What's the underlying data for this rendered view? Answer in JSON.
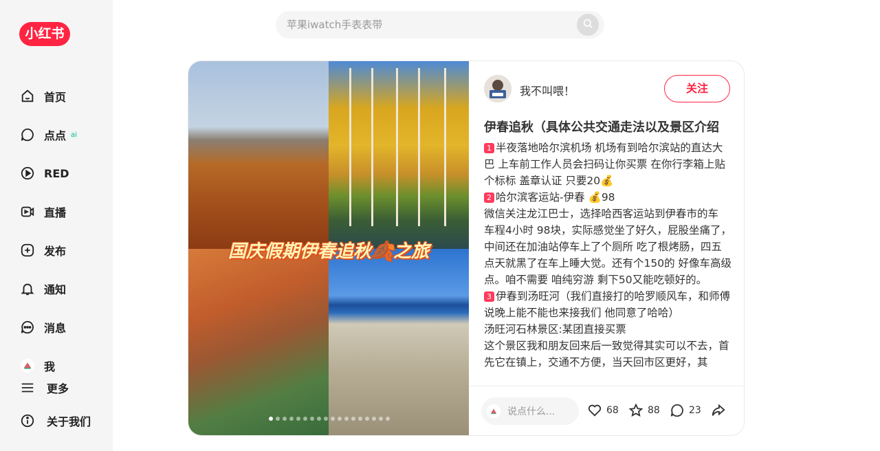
{
  "app": {
    "logo_text": "小红书"
  },
  "sidebar": {
    "items": [
      {
        "label": "首页",
        "icon": "home-icon"
      },
      {
        "label": "点点",
        "icon": "chat-bubble-icon",
        "badge": "ai"
      },
      {
        "label": "RED",
        "icon": "play-circle-icon"
      },
      {
        "label": "直播",
        "icon": "live-camera-icon"
      },
      {
        "label": "发布",
        "icon": "plus-square-icon"
      },
      {
        "label": "通知",
        "icon": "bell-icon"
      },
      {
        "label": "消息",
        "icon": "message-icon"
      },
      {
        "label": "我",
        "icon": "user-avatar-icon"
      }
    ],
    "more_label": "更多",
    "about_label": "关于我们"
  },
  "search": {
    "placeholder": "苹果iwatch手表表带"
  },
  "note": {
    "cover_overlay": "国庆假期伊春追秋🍂之旅",
    "image_count": 18,
    "active_image": 1,
    "author": "我不叫喂！",
    "follow_label": "关注",
    "title": "伊春追秋（具体公共交通走法以及景区介绍",
    "lines": [
      {
        "badge": "1",
        "text": "半夜落地哈尔滨机场 机场有到哈尔滨站的直达大巴 上车前工作人员会扫码让你买票 在你行李箱上贴个标标 盖章认证 只要20💰"
      },
      {
        "badge": "2",
        "text": "哈尔滨客运站-伊春 💰98"
      },
      {
        "badge": "",
        "text": "微信关注龙江巴士，选择哈西客运站到伊春市的车 车程4小时 98块，实际感觉坐了好久，屁股坐痛了，中间还在加油站停车上了个厕所 吃了根烤肠，四五点天就黑了在车上睡大觉。还有个150的 好像车高级点。咱不需要 咱纯穷游 剩下50又能吃顿好的。"
      },
      {
        "badge": "3",
        "text": "伊春到汤旺河（我们直接打的哈罗顺风车，和师傅说晚上能不能也来接我们 他同意了哈哈）"
      },
      {
        "badge": "",
        "text": "汤旺河石林景区:某团直接买票"
      },
      {
        "badge": "",
        "text": "这个景区我和朋友回来后一致觉得其实可以不去，首先它在镇上，交通不方便，当天回市区更好，其"
      }
    ],
    "comment_placeholder": "说点什么...",
    "likes": "68",
    "collects": "88",
    "comments": "23"
  },
  "colors": {
    "brand": "#ff2442",
    "badge": "#ff3b5c"
  }
}
